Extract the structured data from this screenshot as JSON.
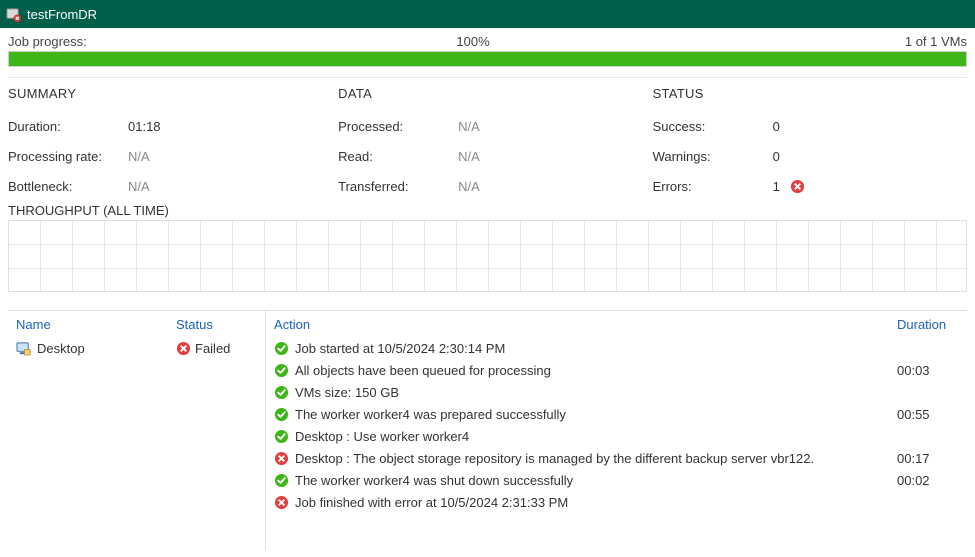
{
  "window": {
    "title": "testFromDR"
  },
  "progress": {
    "label": "Job progress:",
    "percent_text": "100%",
    "percent_value": 100,
    "vms_text": "1 of 1 VMs"
  },
  "summary": {
    "heading": "SUMMARY",
    "duration_label": "Duration:",
    "duration_value": "01:18",
    "rate_label": "Processing rate:",
    "rate_value": "N/A",
    "bottleneck_label": "Bottleneck:",
    "bottleneck_value": "N/A"
  },
  "data_section": {
    "heading": "DATA",
    "processed_label": "Processed:",
    "processed_value": "N/A",
    "read_label": "Read:",
    "read_value": "N/A",
    "transferred_label": "Transferred:",
    "transferred_value": "N/A"
  },
  "status_section": {
    "heading": "STATUS",
    "success_label": "Success:",
    "success_value": "0",
    "warnings_label": "Warnings:",
    "warnings_value": "0",
    "errors_label": "Errors:",
    "errors_value": "1"
  },
  "throughput_heading": "THROUGHPUT (ALL TIME)",
  "left_table": {
    "col_name": "Name",
    "col_status": "Status",
    "rows": [
      {
        "name": "Desktop",
        "status": "Failed",
        "status_type": "error"
      }
    ]
  },
  "right_table": {
    "col_action": "Action",
    "col_duration": "Duration",
    "rows": [
      {
        "icon": "success",
        "text": "Job started at 10/5/2024 2:30:14 PM",
        "duration": ""
      },
      {
        "icon": "success",
        "text": "All objects have been queued for processing",
        "duration": "00:03"
      },
      {
        "icon": "success",
        "text": "VMs size: 150 GB",
        "duration": ""
      },
      {
        "icon": "success",
        "text": "The worker worker4 was prepared successfully",
        "duration": "00:55"
      },
      {
        "icon": "success",
        "text": "Desktop : Use worker worker4",
        "duration": ""
      },
      {
        "icon": "error",
        "text": "Desktop : The object storage repository is managed by the different backup server vbr122.",
        "duration": "00:17"
      },
      {
        "icon": "success",
        "text": "The worker worker4 was shut down successfully",
        "duration": "00:02"
      },
      {
        "icon": "error",
        "text": "Job finished with error at 10/5/2024 2:31:33 PM",
        "duration": ""
      }
    ]
  }
}
